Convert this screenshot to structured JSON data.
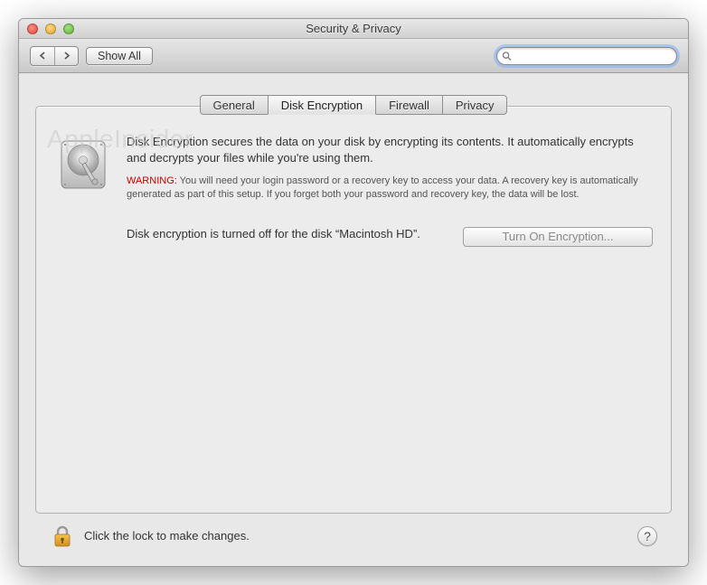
{
  "window": {
    "title": "Security & Privacy"
  },
  "toolbar": {
    "show_all_label": "Show All",
    "search_placeholder": ""
  },
  "tabs": {
    "general": "General",
    "disk_encryption": "Disk Encryption",
    "firewall": "Firewall",
    "privacy": "Privacy",
    "active": "disk_encryption"
  },
  "watermark": "AppleInsider",
  "panel": {
    "description": "Disk Encryption secures the data on your disk by encrypting its contents. It automatically encrypts and decrypts your files while you're using them.",
    "warning_label": "WARNING:",
    "warning_text": "You will need your login password or a recovery key to access your data. A recovery key is automatically generated as part of this setup. If you forget both your password and recovery key, the data will be lost.",
    "status_text": "Disk encryption is turned off for the disk “Macintosh HD”.",
    "turn_on_label": "Turn On Encryption..."
  },
  "footer": {
    "lock_text": "Click the lock to make changes.",
    "help_label": "?"
  }
}
